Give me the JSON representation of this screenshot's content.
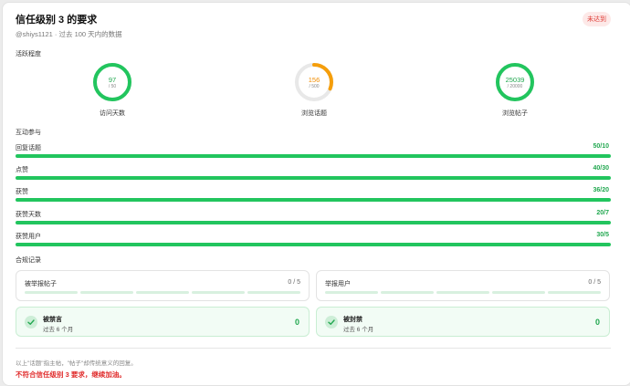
{
  "header": {
    "title": "信任级别 3 的要求",
    "badge": "未达到",
    "subtitle": "@shiys1121 · 过去 100 天内的数据"
  },
  "activity": {
    "section_label": "活跃程度",
    "rings": [
      {
        "value": "97",
        "total": "/ 50",
        "label": "访问天数",
        "fraction": 1.0,
        "color": "#22c55e"
      },
      {
        "value": "156",
        "total": "/ 500",
        "label": "浏览话题",
        "fraction": 0.312,
        "color": "#f59e0b"
      },
      {
        "value": "25039",
        "total": "/ 20000",
        "label": "浏览帖子",
        "fraction": 1.0,
        "color": "#22c55e"
      }
    ]
  },
  "interaction": {
    "section_label": "互动参与",
    "bars": [
      {
        "label": "回复话题",
        "value": "50/10"
      },
      {
        "label": "点赞",
        "value": "40/30"
      },
      {
        "label": "获赞",
        "value": "36/20"
      },
      {
        "label": "获赞天数",
        "value": "20/7"
      },
      {
        "label": "获赞用户",
        "value": "30/5"
      }
    ]
  },
  "compliance": {
    "section_label": "合规记录",
    "reported_posts": {
      "label": "被举报帖子",
      "count": "0 / 5"
    },
    "reporting_users": {
      "label": "举报用户",
      "count": "0 / 5"
    },
    "silenced": {
      "title": "被禁言",
      "period": "过去 6 个月",
      "count": "0"
    },
    "suspended": {
      "title": "被封禁",
      "period": "过去 6 个月",
      "count": "0"
    }
  },
  "footer": {
    "note": "以上\"话题\"指主帖，\"帖子\"却传统意义的回复。",
    "result": "不符合信任级别 3 要求，继续加油。"
  }
}
